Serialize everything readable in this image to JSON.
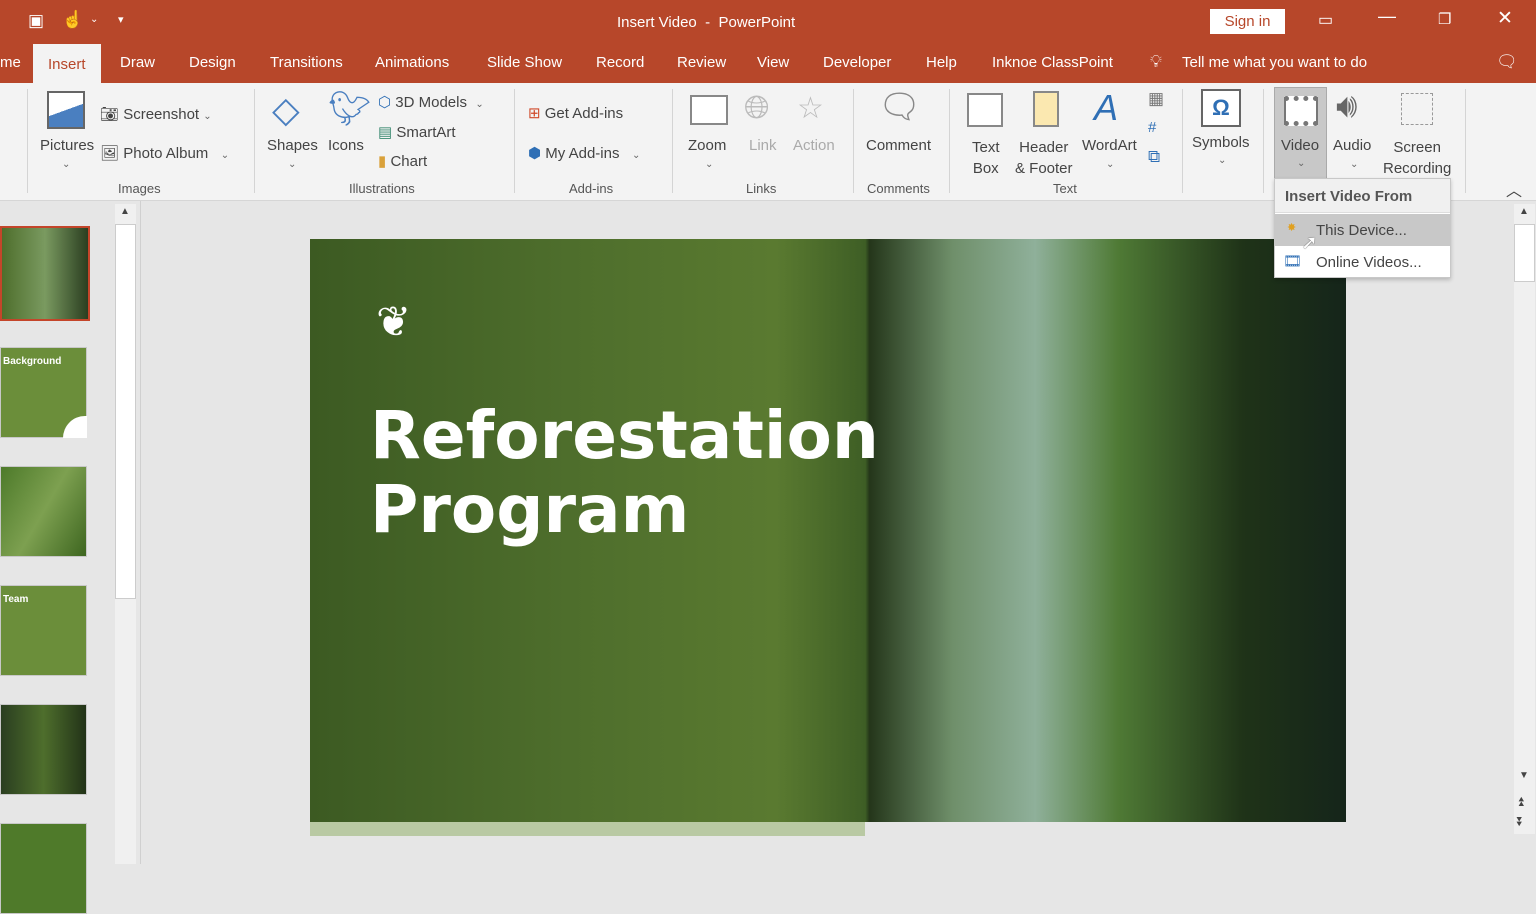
{
  "titlebar": {
    "title": "Insert Video",
    "separator": "-",
    "app": "PowerPoint",
    "sign_in": "Sign in"
  },
  "tabs": [
    {
      "label": "me"
    },
    {
      "label": "Insert"
    },
    {
      "label": "Draw"
    },
    {
      "label": "Design"
    },
    {
      "label": "Transitions"
    },
    {
      "label": "Animations"
    },
    {
      "label": "Slide Show"
    },
    {
      "label": "Record"
    },
    {
      "label": "Review"
    },
    {
      "label": "View"
    },
    {
      "label": "Developer"
    },
    {
      "label": "Help"
    },
    {
      "label": "Inknoe ClassPoint"
    }
  ],
  "tell_me": "Tell me what you want to do",
  "ribbon": {
    "images": {
      "group": "Images",
      "pictures": "Pictures",
      "screenshot": "Screenshot",
      "photo_album": "Photo Album"
    },
    "illustrations": {
      "group": "Illustrations",
      "shapes": "Shapes",
      "icons": "Icons",
      "models": "3D Models",
      "smartart": "SmartArt",
      "chart": "Chart"
    },
    "addins": {
      "group": "Add-ins",
      "get": "Get Add-ins",
      "my": "My Add-ins"
    },
    "links": {
      "group": "Links",
      "zoom": "Zoom",
      "link": "Link",
      "action": "Action"
    },
    "comments": {
      "group": "Comments",
      "comment": "Comment"
    },
    "text": {
      "group": "Text",
      "textbox1": "Text",
      "textbox2": "Box",
      "header1": "Header",
      "header2": "& Footer",
      "wordart": "WordArt"
    },
    "symbols": {
      "symbols": "Symbols"
    },
    "media": {
      "video": "Video",
      "audio": "Audio",
      "screen1": "Screen",
      "screen2": "Recording"
    }
  },
  "video_menu": {
    "header": "Insert Video From",
    "items": [
      {
        "label": "This Device..."
      },
      {
        "label": "Online Videos..."
      }
    ]
  },
  "thumbnails": [
    {
      "title": ""
    },
    {
      "title": "Background"
    },
    {
      "title": ""
    },
    {
      "title": "Team"
    },
    {
      "title": ""
    },
    {
      "title": ""
    }
  ],
  "slide": {
    "title_line1": "Reforestation",
    "title_line2": "Program"
  },
  "colors": {
    "accent": "#b7472a",
    "slide_green": "#6b8e3a"
  }
}
